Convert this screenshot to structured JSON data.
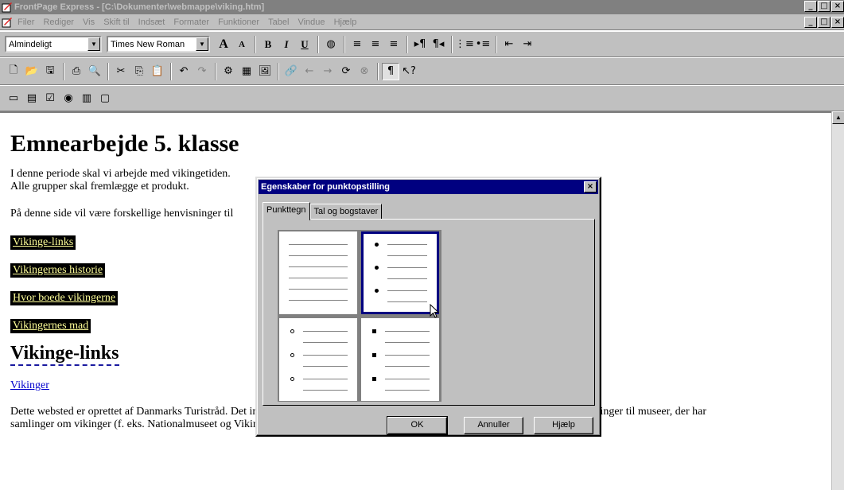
{
  "window": {
    "title": "FrontPage Express - [C:\\Dokumenter\\webmappe\\viking.htm]",
    "controls": [
      "_",
      "□",
      "×"
    ]
  },
  "menu": {
    "items": [
      "Filer",
      "Rediger",
      "Vis",
      "Skift til",
      "Indsæt",
      "Formater",
      "Funktioner",
      "Tabel",
      "Vindue",
      "Hjælp"
    ]
  },
  "format_toolbar": {
    "style_value": "Almindeligt",
    "font_value": "Times New Roman",
    "grow_font": "A",
    "shrink_font": "A",
    "bold": "B",
    "italic": "I",
    "underline": "U"
  },
  "document": {
    "heading": "Emnearbejde 5. klasse",
    "intro_line1": "I denne periode skal vi arbejde med vikingetiden.",
    "intro_line2": "Alle grupper skal fremlægge et produkt.",
    "info_line": "På denne side vil være forskellige henvisninger til",
    "links": [
      "Vikinge-links",
      "Vikingernes historie",
      "Hvor boede vikingerne",
      "Vikingernes mad"
    ],
    "section_heading": "Vikinge-links",
    "section_link": "Vikinger",
    "body_line1": "Dette websted er oprettet af Danmarks Turistråd. Det indeholder oplysninger om vikingerne på togt og hjemme. Der er også henvisninger til museer, der har",
    "body_line2": "samlinger om vikinger (f. eks. Nationalmuseet og Vikingehallen) og monumenter (f. eks. Trelleborg og Jelling)",
    "return_mark": "↵"
  },
  "dialog": {
    "title": "Egenskaber for punktopstilling",
    "tabs": [
      "Punkttegn",
      "Tal og bogstaver"
    ],
    "active_tab": "Punkttegn",
    "bullet_styles": [
      "none",
      "dot",
      "circle",
      "square"
    ],
    "selected_style": "dot",
    "buttons": {
      "ok": "OK",
      "cancel": "Annuller",
      "help": "Hjælp"
    },
    "close": "×"
  },
  "colors": {
    "dialog_title_bg": "#000080",
    "link_box_bg": "#000000",
    "link_box_text": "#ffff99",
    "hyperlink": "#0000cc"
  }
}
